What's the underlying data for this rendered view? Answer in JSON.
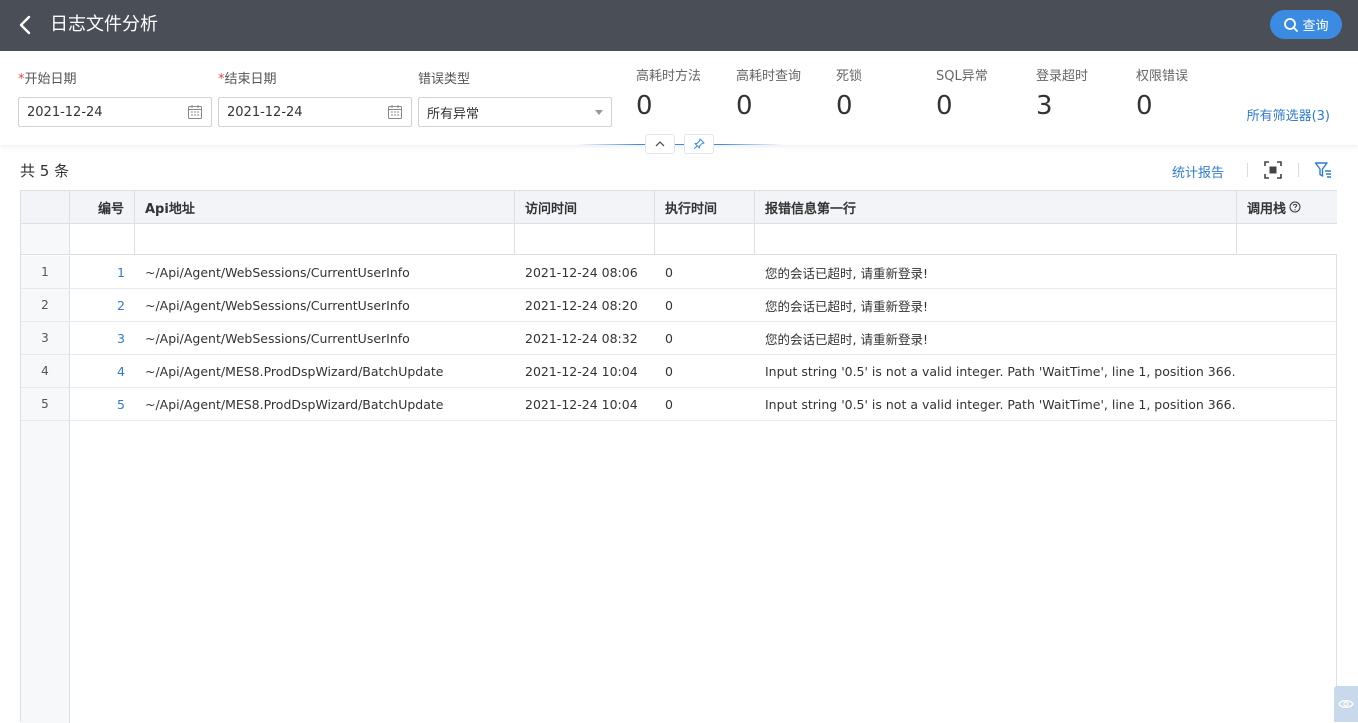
{
  "header": {
    "title": "日志文件分析",
    "query_label": "查询"
  },
  "filters": {
    "start_date": {
      "label": "开始日期",
      "required_mark": "*",
      "value": "2021-12-24"
    },
    "end_date": {
      "label": "结束日期",
      "required_mark": "*",
      "value": "2021-12-24"
    },
    "error_type": {
      "label": "错误类型",
      "value": "所有异常"
    },
    "all_filters_label": "所有筛选器(3)"
  },
  "stats": [
    {
      "label": "高耗时方法",
      "value": "0"
    },
    {
      "label": "高耗时查询",
      "value": "0"
    },
    {
      "label": "死锁",
      "value": "0"
    },
    {
      "label": "SQL异常",
      "value": "0"
    },
    {
      "label": "登录超时",
      "value": "3"
    },
    {
      "label": "权限错误",
      "value": "0"
    }
  ],
  "toolbar": {
    "count_label": "共 5 条",
    "report_label": "统计报告"
  },
  "table": {
    "columns": [
      "编号",
      "Api地址",
      "访问时间",
      "执行时间",
      "报错信息第一行",
      "调用栈"
    ],
    "rows": [
      {
        "idx": "1",
        "no": "1",
        "api": "~/Api/Agent/WebSessions/CurrentUserInfo",
        "time": "2021-12-24 08:06",
        "exec": "0",
        "msg": "您的会话已超时, 请重新登录!",
        "stack": ""
      },
      {
        "idx": "2",
        "no": "2",
        "api": "~/Api/Agent/WebSessions/CurrentUserInfo",
        "time": "2021-12-24 08:20",
        "exec": "0",
        "msg": "您的会话已超时, 请重新登录!",
        "stack": ""
      },
      {
        "idx": "3",
        "no": "3",
        "api": "~/Api/Agent/WebSessions/CurrentUserInfo",
        "time": "2021-12-24 08:32",
        "exec": "0",
        "msg": "您的会话已超时, 请重新登录!",
        "stack": ""
      },
      {
        "idx": "4",
        "no": "4",
        "api": "~/Api/Agent/MES8.ProdDspWizard/BatchUpdate",
        "time": "2021-12-24 10:04",
        "exec": "0",
        "msg": "Input string '0.5' is not a valid integer. Path 'WaitTime', line 1, position 366.",
        "stack": ""
      },
      {
        "idx": "5",
        "no": "5",
        "api": "~/Api/Agent/MES8.ProdDspWizard/BatchUpdate",
        "time": "2021-12-24 10:04",
        "exec": "0",
        "msg": "Input string '0.5' is not a valid integer. Path 'WaitTime', line 1, position 366.",
        "stack": ""
      }
    ]
  },
  "colors": {
    "header_bg": "#4a4f57",
    "accent": "#3b8be2",
    "link": "#2f7bd1"
  },
  "icons": [
    "back-arrow-icon",
    "search-icon",
    "calendar-icon",
    "chevron-up-icon",
    "pin-icon",
    "fullscreen-icon",
    "filter-icon",
    "help-icon",
    "eye-icon"
  ]
}
